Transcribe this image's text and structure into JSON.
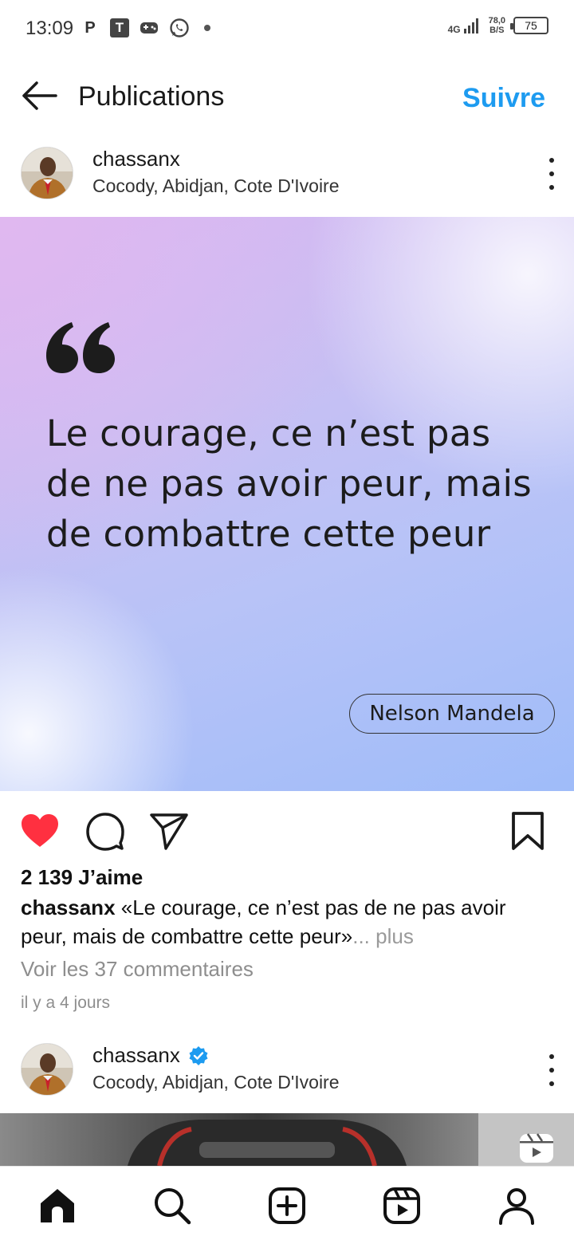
{
  "status_bar": {
    "time": "13:09",
    "left_icons": [
      "p-icon",
      "t-icon",
      "game-icon",
      "whatsapp-icon"
    ],
    "network": "4G",
    "speed_value": "78,0",
    "speed_unit": "B/S",
    "battery": "75"
  },
  "header": {
    "title": "Publications",
    "follow_label": "Suivre"
  },
  "post1": {
    "username": "chassanx",
    "location": "Cocody, Abidjan, Cote D'Ivoire",
    "quote_text": "Le courage, ce n’est pas de ne pas avoir peur, mais de combattre cette peur",
    "quote_author": "Nelson Mandela",
    "likes": "2 139 J’aime",
    "caption_user": "chassanx",
    "caption_text": "«Le courage, ce n’est pas de ne pas avoir peur, mais de combattre cette peur»",
    "caption_more": "... plus",
    "comments_link": "Voir les 37 commentaires",
    "time_ago": "il y a 4 jours",
    "liked": true
  },
  "post2": {
    "username": "chassanx",
    "location": "Cocody, Abidjan, Cote D'Ivoire",
    "verified": true
  },
  "nav": {
    "items": [
      "home-icon",
      "search-icon",
      "create-icon",
      "reels-icon",
      "profile-icon"
    ]
  },
  "colors": {
    "accent": "#1d9bf0",
    "like": "#ff3040"
  }
}
